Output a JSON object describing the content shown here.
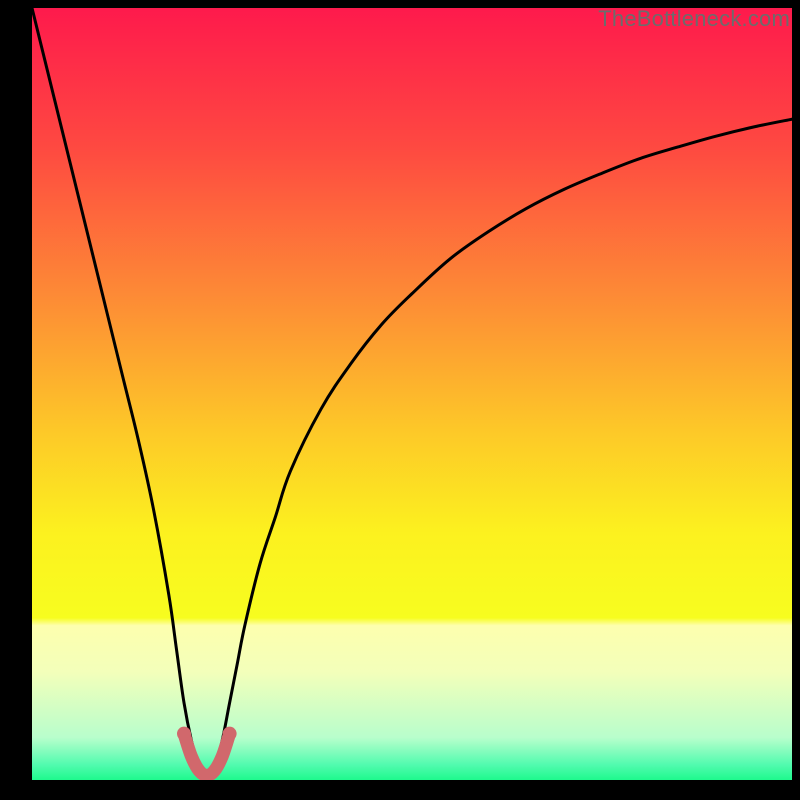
{
  "watermark": "TheBottleneck.com",
  "chart_data": {
    "type": "line",
    "title": "",
    "xlabel": "",
    "ylabel": "",
    "xlim": [
      0,
      100
    ],
    "ylim": [
      0,
      100
    ],
    "grid": false,
    "x_optimum": 23,
    "series": [
      {
        "name": "bottleneck-curve",
        "color": "#000000",
        "x": [
          0,
          2,
          4,
          6,
          8,
          10,
          12,
          14,
          16,
          18,
          19,
          20,
          21,
          22,
          23,
          24,
          25,
          26,
          27,
          28,
          30,
          32,
          34,
          38,
          42,
          46,
          50,
          55,
          60,
          65,
          70,
          75,
          80,
          85,
          90,
          95,
          100
        ],
        "values": [
          100,
          92,
          84,
          76,
          68,
          60,
          52,
          44,
          35,
          24,
          17,
          10,
          5,
          1.5,
          0.5,
          1.5,
          5,
          10,
          15,
          20,
          28,
          34,
          40,
          48,
          54,
          59,
          63,
          67.5,
          71,
          74,
          76.5,
          78.6,
          80.5,
          82,
          83.4,
          84.6,
          85.6
        ]
      },
      {
        "name": "optimum-marker",
        "color": "#d1686c",
        "x_points": [
          20,
          21,
          22,
          23,
          24,
          25,
          26
        ],
        "y_points": [
          6,
          3,
          1.2,
          0.6,
          1.2,
          3,
          6
        ]
      }
    ],
    "gradient_stops": [
      {
        "offset": 0,
        "color": "#fe1a4c"
      },
      {
        "offset": 18,
        "color": "#fe4941"
      },
      {
        "offset": 38,
        "color": "#fd8d35"
      },
      {
        "offset": 55,
        "color": "#fdc928"
      },
      {
        "offset": 68,
        "color": "#fcf11f"
      },
      {
        "offset": 79,
        "color": "#f7fd1f"
      },
      {
        "offset": 80,
        "color": "#fdffae"
      },
      {
        "offset": 86,
        "color": "#f3ffba"
      },
      {
        "offset": 94.5,
        "color": "#b8fecc"
      },
      {
        "offset": 98,
        "color": "#52fbaf"
      },
      {
        "offset": 100,
        "color": "#1ef98d"
      }
    ]
  }
}
